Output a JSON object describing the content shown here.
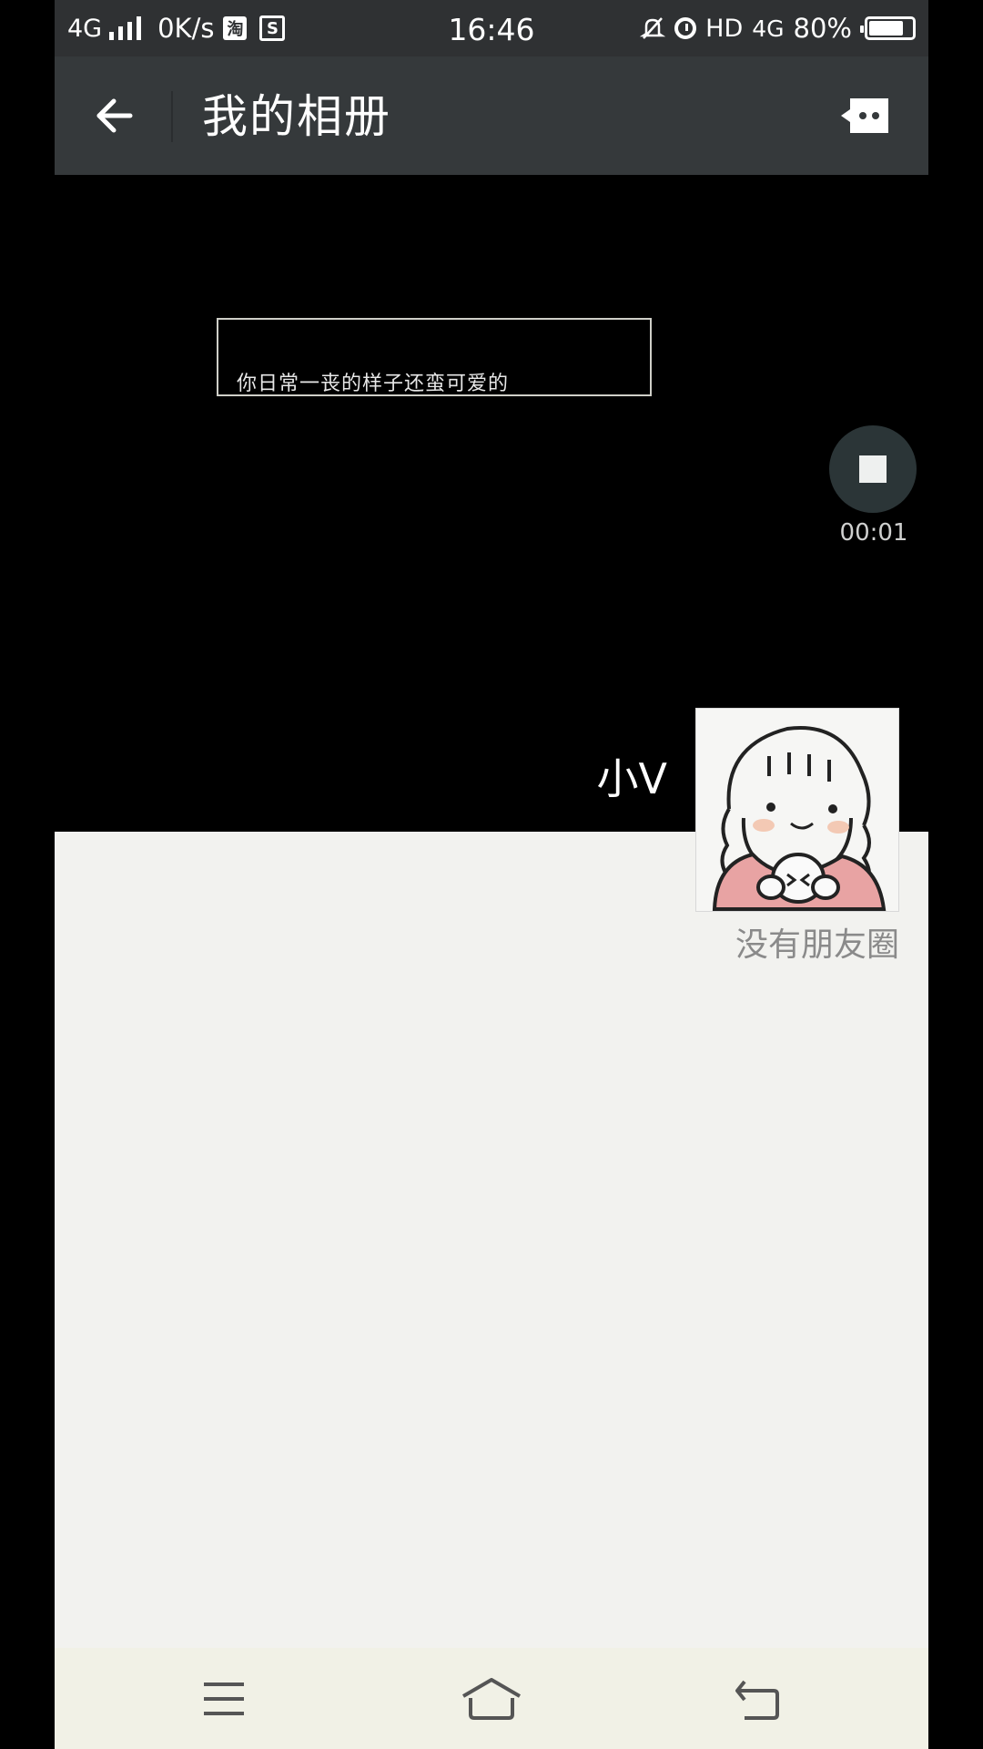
{
  "status_bar": {
    "network": "4G",
    "speed": "0K/s",
    "app_icon_label": "淘",
    "s_icon_label": "S",
    "time": "16:46",
    "hd": "HD",
    "network_right": "4G",
    "battery": "80%",
    "battery_level": 0.8
  },
  "header": {
    "title": "我的相册"
  },
  "cover": {
    "caption": "你日常一丧的样子还蛮可爱的",
    "timer": "00:01"
  },
  "profile": {
    "name": "小V",
    "empty_text": "没有朋友圈"
  },
  "colors": {
    "status_bar": "#2f3133",
    "title_bar": "#35393b",
    "content_bg": "#f2f2ef",
    "nav_bg": "#f1f1e6"
  },
  "icons": {
    "back": "arrow-left-icon",
    "more": "chat-bubble-more-icon",
    "stop": "stop-icon",
    "menu": "menu-icon",
    "home": "home-icon",
    "return": "return-icon"
  }
}
